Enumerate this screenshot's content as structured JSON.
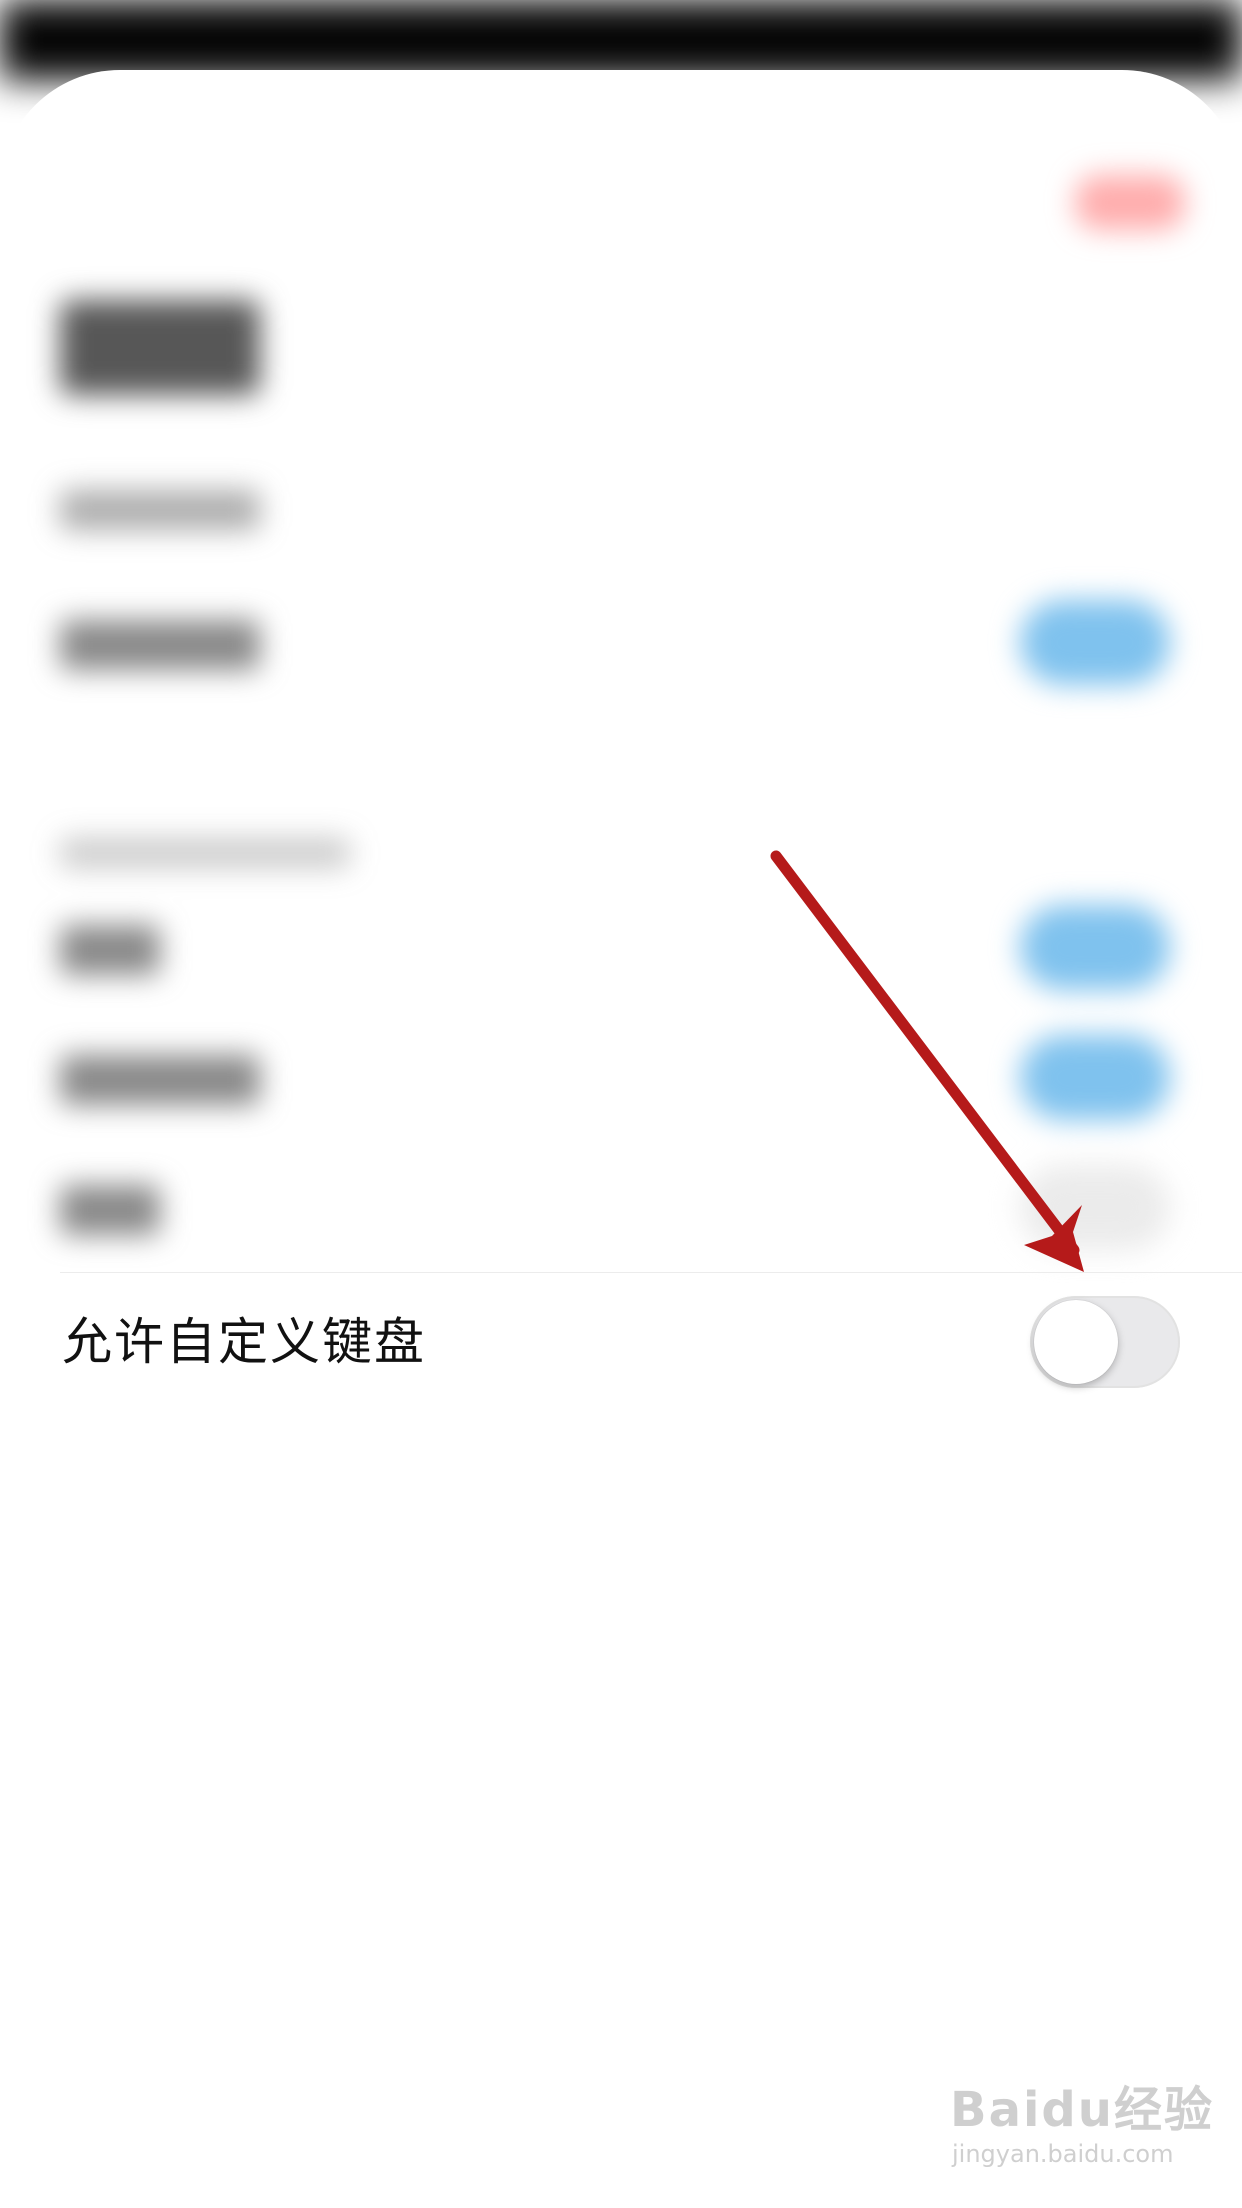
{
  "setting": {
    "label": "允许自定义键盘",
    "enabled": false
  },
  "watermark": {
    "main": "Baidu经验",
    "sub": "jingyan.baidu.com"
  },
  "colors": {
    "annotation_arrow": "#b51a1a",
    "switch_off_track": "#e9e9eb",
    "blurred_toggle_on": "#7fc2ee"
  }
}
